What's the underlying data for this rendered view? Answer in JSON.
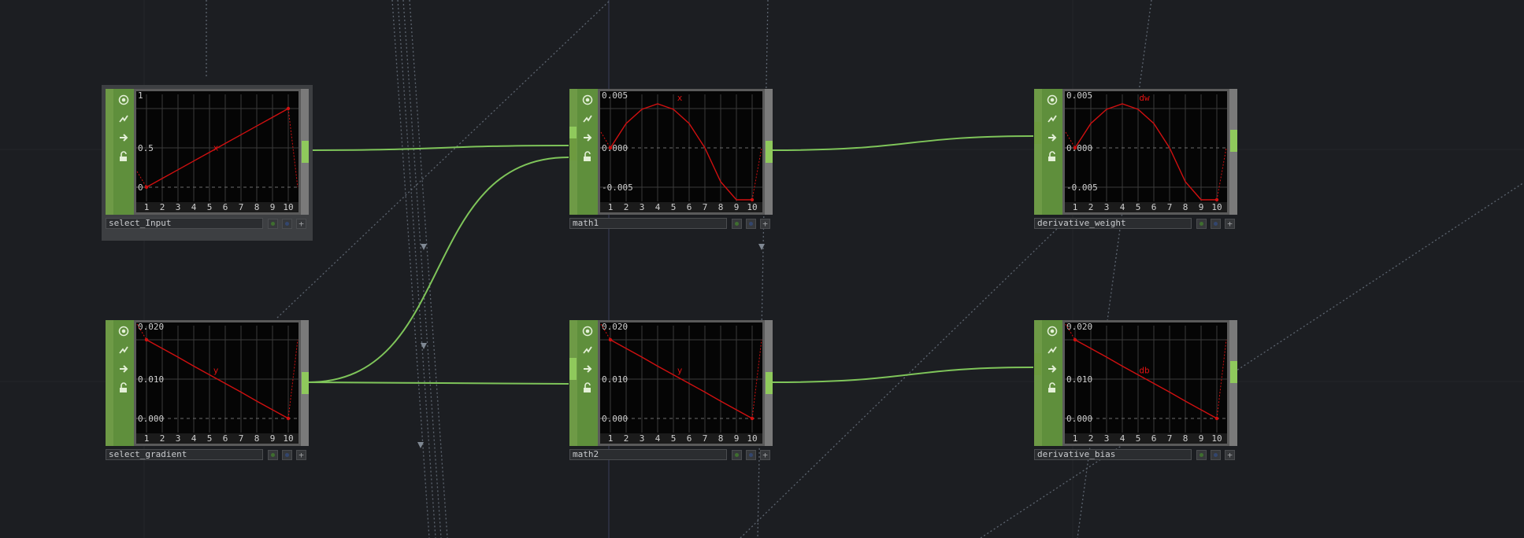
{
  "app": "TouchDesigner network editor",
  "colors": {
    "background": "#1c1e22",
    "wire": "#7fc55a",
    "curve": "#d01010",
    "node_green": "#6e9a46"
  },
  "node_icons": [
    "viewer-toggle-icon",
    "cooking-icon",
    "export-arrow-icon",
    "lock-icon"
  ],
  "nodes": [
    {
      "id": "select_input",
      "name": "select_Input",
      "selected": true,
      "channel": "x",
      "y_ticks": [
        "1",
        "0.5",
        "0"
      ],
      "x_ticks": [
        "1",
        "2",
        "3",
        "4",
        "5",
        "6",
        "7",
        "8",
        "9",
        "10"
      ],
      "samples": [
        0.0,
        0.111,
        0.222,
        0.333,
        0.444,
        0.556,
        0.667,
        0.778,
        0.889,
        1.0
      ]
    },
    {
      "id": "math1",
      "name": "math1",
      "selected": false,
      "channel": "x",
      "y_ticks": [
        "0.005",
        "0.000",
        "-0.005"
      ],
      "x_ticks": [
        "1",
        "2",
        "3",
        "4",
        "5",
        "6",
        "7",
        "8",
        "9",
        "10"
      ],
      "samples": [
        0.0,
        0.0031,
        0.0049,
        0.0056,
        0.0049,
        0.0031,
        0.0,
        -0.0043,
        -0.0099,
        -0.0167
      ]
    },
    {
      "id": "derivative_weight",
      "name": "derivative_weight",
      "selected": false,
      "channel": "dw",
      "y_ticks": [
        "0.005",
        "0.000",
        "-0.005"
      ],
      "x_ticks": [
        "1",
        "2",
        "3",
        "4",
        "5",
        "6",
        "7",
        "8",
        "9",
        "10"
      ],
      "samples": [
        0.0,
        0.0031,
        0.0049,
        0.0056,
        0.0049,
        0.0031,
        0.0,
        -0.0043,
        -0.0099,
        -0.0167
      ]
    },
    {
      "id": "select_gradient",
      "name": "select_gradient",
      "selected": false,
      "channel": "y",
      "y_ticks": [
        "0.020",
        "0.010",
        "0.000"
      ],
      "x_ticks": [
        "1",
        "2",
        "3",
        "4",
        "5",
        "6",
        "7",
        "8",
        "9",
        "10"
      ],
      "samples": [
        0.02,
        0.0178,
        0.0156,
        0.0133,
        0.0111,
        0.0089,
        0.0067,
        0.0044,
        0.0022,
        0.0
      ]
    },
    {
      "id": "math2",
      "name": "math2",
      "selected": false,
      "channel": "y",
      "y_ticks": [
        "0.020",
        "0.010",
        "0.000"
      ],
      "x_ticks": [
        "1",
        "2",
        "3",
        "4",
        "5",
        "6",
        "7",
        "8",
        "9",
        "10"
      ],
      "samples": [
        0.02,
        0.0178,
        0.0156,
        0.0133,
        0.0111,
        0.0089,
        0.0067,
        0.0044,
        0.0022,
        0.0
      ]
    },
    {
      "id": "derivative_bias",
      "name": "derivative_bias",
      "selected": false,
      "channel": "db",
      "y_ticks": [
        "0.020",
        "0.010",
        "0.000"
      ],
      "x_ticks": [
        "1",
        "2",
        "3",
        "4",
        "5",
        "6",
        "7",
        "8",
        "9",
        "10"
      ],
      "samples": [
        0.02,
        0.0178,
        0.0156,
        0.0133,
        0.0111,
        0.0089,
        0.0067,
        0.0044,
        0.0022,
        0.0
      ]
    }
  ],
  "wires": [
    {
      "from": "select_input",
      "to": "math1"
    },
    {
      "from": "select_gradient",
      "to": "math1"
    },
    {
      "from": "select_gradient",
      "to": "math2"
    },
    {
      "from": "math1",
      "to": "derivative_weight"
    },
    {
      "from": "math2",
      "to": "derivative_bias"
    }
  ]
}
